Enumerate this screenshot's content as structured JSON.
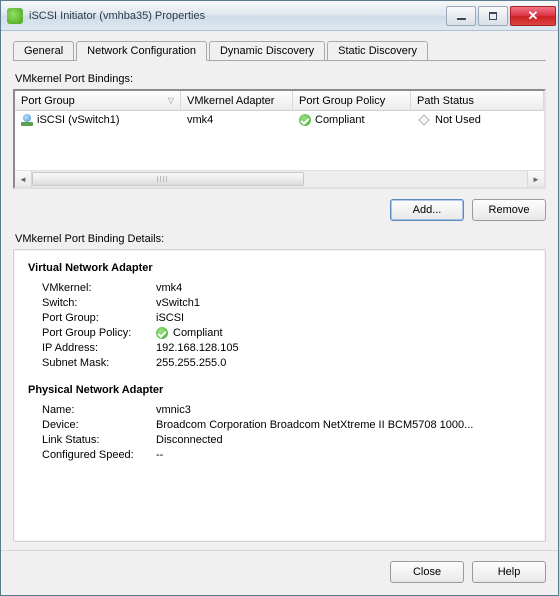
{
  "window": {
    "title": "iSCSI Initiator (vmhba35) Properties"
  },
  "tabs": {
    "general": "General",
    "network": "Network Configuration",
    "dynamic": "Dynamic Discovery",
    "static": "Static Discovery"
  },
  "bindings": {
    "label": "VMkernel Port Bindings:",
    "columns": {
      "port_group": "Port Group",
      "adapter": "VMkernel Adapter",
      "policy": "Port Group Policy",
      "path": "Path Status"
    },
    "rows": [
      {
        "port_group": "iSCSI (vSwitch1)",
        "adapter": "vmk4",
        "policy": "Compliant",
        "path": "Not Used"
      }
    ],
    "buttons": {
      "add": "Add...",
      "remove": "Remove"
    }
  },
  "details": {
    "label": "VMkernel Port Binding Details:",
    "virtual": {
      "title": "Virtual Network Adapter",
      "vmkernel_l": "VMkernel:",
      "vmkernel_v": "vmk4",
      "switch_l": "Switch:",
      "switch_v": "vSwitch1",
      "pg_l": "Port Group:",
      "pg_v": "iSCSI",
      "policy_l": "Port Group Policy:",
      "policy_v": "Compliant",
      "ip_l": "IP Address:",
      "ip_v": "192.168.128.105",
      "mask_l": "Subnet Mask:",
      "mask_v": "255.255.255.0"
    },
    "physical": {
      "title": "Physical Network Adapter",
      "name_l": "Name:",
      "name_v": "vmnic3",
      "device_l": "Device:",
      "device_v": "Broadcom Corporation Broadcom NetXtreme II BCM5708 1000...",
      "link_l": "Link Status:",
      "link_v": "Disconnected",
      "speed_l": "Configured Speed:",
      "speed_v": "--"
    }
  },
  "footer": {
    "close": "Close",
    "help": "Help"
  }
}
